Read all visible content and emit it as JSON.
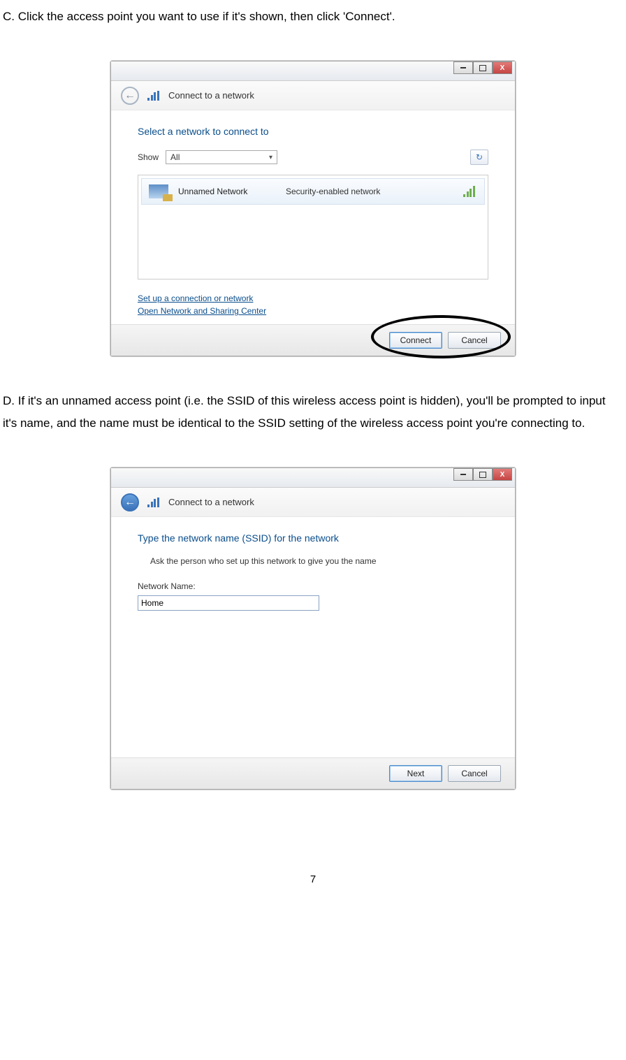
{
  "text": {
    "instruction_c": "C. Click the access point you want to use if it's shown, then click 'Connect'.",
    "instruction_d": "D. If it's an unnamed access point (i.e. the SSID of this wireless access point is hidden), you'll be prompted to input it's name, and the name must be identical to the SSID setting of the wireless access point you're connecting to.",
    "page_number": "7"
  },
  "dialog1": {
    "nav_title": "Connect to a network",
    "close_x": "X",
    "section_title": "Select a network to connect to",
    "show_label": "Show",
    "show_value": "All",
    "refresh_glyph": "↻",
    "network": {
      "name": "Unnamed Network",
      "security": "Security-enabled network"
    },
    "link_setup": "Set up a connection or network",
    "link_center": "Open Network and Sharing Center",
    "btn_connect": "Connect",
    "btn_cancel": "Cancel"
  },
  "dialog2": {
    "nav_title": "Connect to a network",
    "close_x": "X",
    "section_title": "Type the network name (SSID) for the network",
    "subnote": "Ask the person who set up this network to give you the name",
    "field_label": "Network Name:",
    "field_value": "Home",
    "btn_next": "Next",
    "btn_cancel": "Cancel"
  }
}
